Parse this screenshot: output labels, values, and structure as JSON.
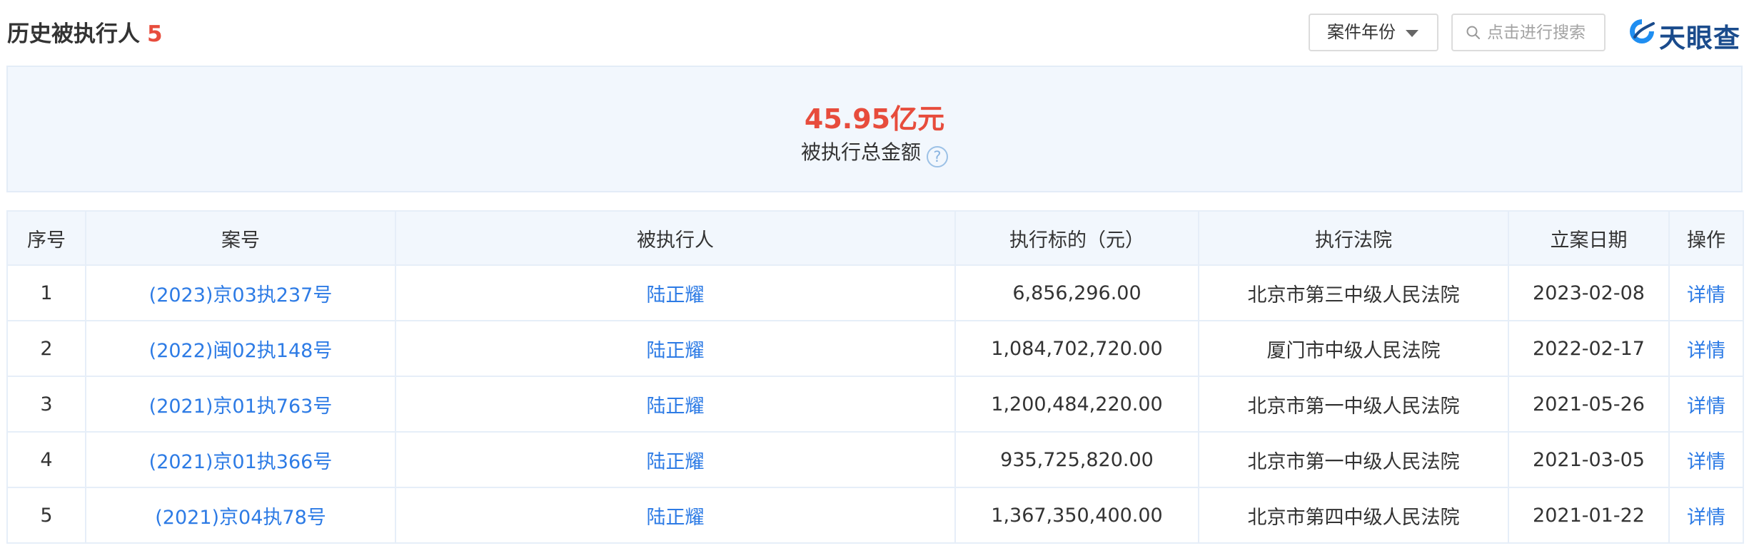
{
  "header": {
    "title": "历史被执行人",
    "count": "5",
    "year_select_label": "案件年份",
    "search_placeholder": "点击进行搜索",
    "logo_text": "天眼查"
  },
  "summary": {
    "amount": "45.95亿元",
    "label": "被执行总金额",
    "help_icon_glyph": "?"
  },
  "table": {
    "columns": [
      "序号",
      "案号",
      "被执行人",
      "执行标的（元）",
      "执行法院",
      "立案日期",
      "操作"
    ],
    "rows": [
      {
        "index": "1",
        "case_no": "(2023)京03执237号",
        "person": "陆正耀",
        "amount": "6,856,296.00",
        "court": "北京市第三中级人民法院",
        "date": "2023-02-08",
        "action": "详情"
      },
      {
        "index": "2",
        "case_no": "(2022)闽02执148号",
        "person": "陆正耀",
        "amount": "1,084,702,720.00",
        "court": "厦门市中级人民法院",
        "date": "2022-02-17",
        "action": "详情"
      },
      {
        "index": "3",
        "case_no": "(2021)京01执763号",
        "person": "陆正耀",
        "amount": "1,200,484,220.00",
        "court": "北京市第一中级人民法院",
        "date": "2021-05-26",
        "action": "详情"
      },
      {
        "index": "4",
        "case_no": "(2021)京01执366号",
        "person": "陆正耀",
        "amount": "935,725,820.00",
        "court": "北京市第一中级人民法院",
        "date": "2021-03-05",
        "action": "详情"
      },
      {
        "index": "5",
        "case_no": "(2021)京04执78号",
        "person": "陆正耀",
        "amount": "1,367,350,400.00",
        "court": "北京市第四中级人民法院",
        "date": "2021-01-22",
        "action": "详情"
      }
    ]
  },
  "colors": {
    "accent_red": "#e74c3c",
    "link_blue": "#2d7be5",
    "header_bg": "#f2f7fd",
    "border": "#e6eef8",
    "logo_blue": "#1a4b8c"
  },
  "icons": {
    "search": "search-icon",
    "dropdown": "caret-down-icon",
    "help": "question-circle-icon",
    "logo": "tianyancha-logo-icon"
  }
}
